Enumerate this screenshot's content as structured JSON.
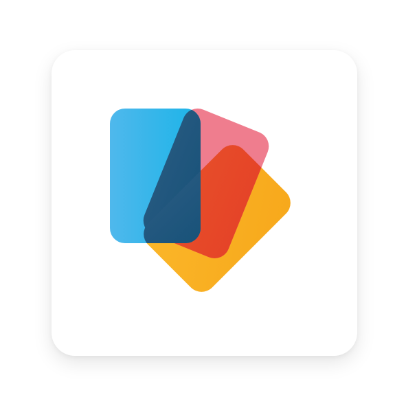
{
  "icon": {
    "name": "overlapping-cards-app-icon"
  },
  "colors": {
    "background": "#ffffff",
    "tile": "#ffffff",
    "card_blue_light": "#4FB8EC",
    "card_blue": "#1BB4E8",
    "card_pink": "#EF7D8E",
    "card_orange_light": "#FBB72A",
    "card_orange": "#F7A81B",
    "overlap_red": "#E8522A",
    "overlap_red_dark": "#E54428",
    "overlap_navy": "#24587F",
    "overlap_navy_dark": "#0E4E74"
  }
}
